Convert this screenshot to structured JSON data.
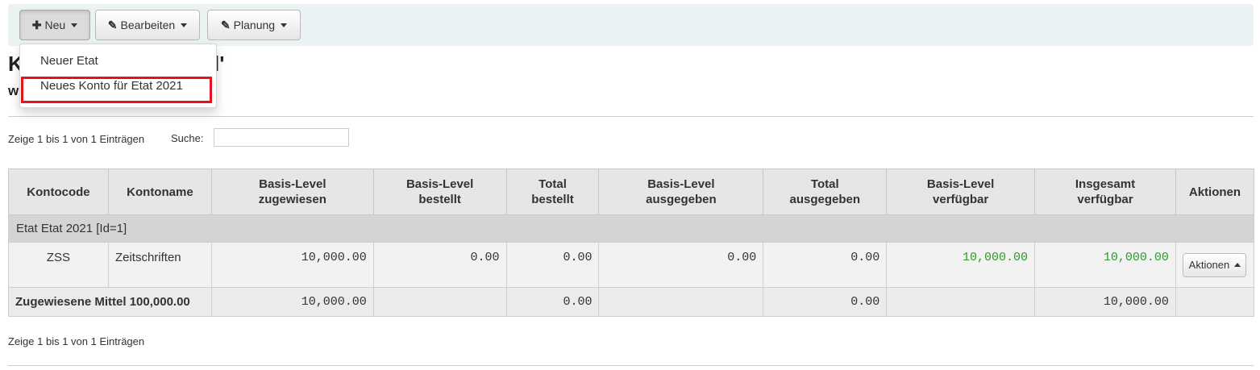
{
  "toolbar": {
    "new_label": "Neu",
    "edit_label": "Bearbeiten",
    "plan_label": "Planung"
  },
  "page": {
    "title_visible": "K",
    "title_suffix": "l'",
    "subtitle_visible": "w"
  },
  "dropdown": {
    "items": [
      {
        "label": "Neuer Etat"
      },
      {
        "label": "Neues Konto für Etat 2021"
      }
    ]
  },
  "list": {
    "info_top": "Zeige 1 bis 1 von 1 Einträgen",
    "info_bottom": "Zeige 1 bis 1 von 1 Einträgen",
    "search_label": "Suche:",
    "search_value": ""
  },
  "table": {
    "headers": [
      {
        "line1": "Kontocode",
        "line2": ""
      },
      {
        "line1": "Kontoname",
        "line2": ""
      },
      {
        "line1": "Basis-Level",
        "line2": "zugewiesen"
      },
      {
        "line1": "Basis-Level",
        "line2": "bestellt"
      },
      {
        "line1": "Total",
        "line2": "bestellt"
      },
      {
        "line1": "Basis-Level",
        "line2": "ausgegeben"
      },
      {
        "line1": "Total",
        "line2": "ausgegeben"
      },
      {
        "line1": "Basis-Level",
        "line2": "verfügbar"
      },
      {
        "line1": "Insgesamt",
        "line2": "verfügbar"
      },
      {
        "line1": "Aktionen",
        "line2": ""
      }
    ],
    "group_label": "Etat Etat 2021 [Id=1]",
    "row": {
      "code": "ZSS",
      "name": "Zeitschriften",
      "allocated": "10,000.00",
      "ordered": "0.00",
      "total_ordered": "0.00",
      "spent": "0.00",
      "total_spent": "0.00",
      "available": "10,000.00",
      "total_available": "10,000.00",
      "actions_label": "Aktionen"
    },
    "total": {
      "label": "Zugewiesene Mittel 100,000.00",
      "allocated": "10,000.00",
      "total_ordered": "0.00",
      "total_spent": "0.00",
      "total_available": "10,000.00"
    }
  },
  "colors": {
    "toolbar_bg": "#eaf2f3",
    "available_green": "#2a9a2a",
    "highlight_red": "#e3141e"
  }
}
